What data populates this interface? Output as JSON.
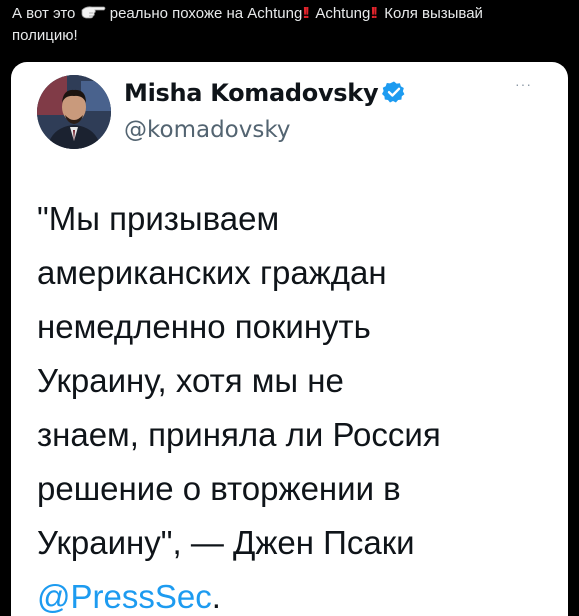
{
  "post": {
    "caption_part1": "А вот это",
    "caption_part2": "реально похоже на Achtung",
    "caption_part3": "Achtung",
    "caption_part4": "Коля вызывай",
    "caption_line2": "полицию!",
    "bang": "!!",
    "pointing_icon": "backhand-index-pointing-right-icon"
  },
  "tweet": {
    "display_name": "Misha Komadovsky",
    "handle": "@komadovsky",
    "more_label": "···",
    "text_lines": [
      "\"Мы призываем",
      "американских граждан",
      "немедленно покинуть",
      "Украину, хотя мы не",
      "знаем, приняла ли Россия",
      "решение о вторжении в",
      "Украину\", — Джен Псаки"
    ],
    "mention": "@PressSec",
    "mention_suffix": ".",
    "colors": {
      "verified": "#1d9bf0",
      "mention": "#1d9bf0",
      "text": "#0f1419",
      "handle": "#536471"
    }
  }
}
